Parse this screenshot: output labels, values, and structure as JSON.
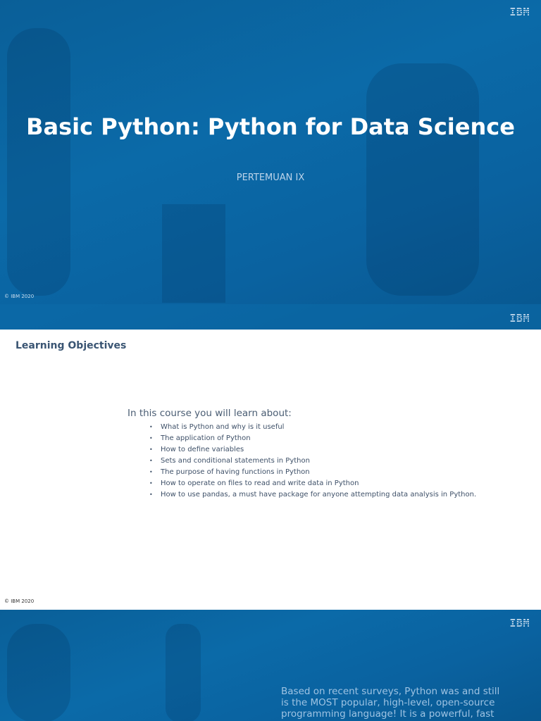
{
  "slide1": {
    "title": "Basic Python: Python for Data Science",
    "subtitle": "PERTEMUAN IX",
    "copyright": "© IBM 2020",
    "logo": "IBM"
  },
  "slide2": {
    "logo": "IBM",
    "heading": "Learning Objectives",
    "intro": "In this course you will learn about:",
    "bullets": [
      "What is Python and why is it useful",
      "The application of Python",
      "How to define variables",
      "Sets and conditional statements in Python",
      "The purpose of having functions in Python",
      "How to operate on files to read and write data in Python",
      "How to use pandas, a must have package for anyone attempting data analysis in Python."
    ],
    "copyright": "© IBM 2020"
  },
  "slide3": {
    "logo": "IBM",
    "text": "Based on recent surveys, Python was and still is the MOST popular, high-level, open-source programming language! It is a powerful, fast"
  }
}
